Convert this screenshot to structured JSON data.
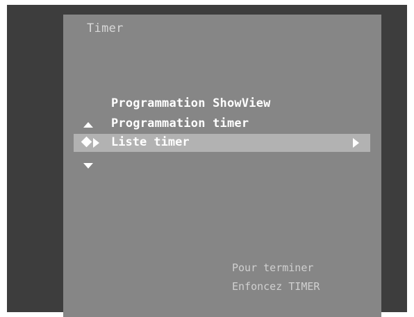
{
  "window": {
    "title": "Timer"
  },
  "menu": {
    "items": [
      {
        "label": "Programmation ShowView"
      },
      {
        "label": "Programmation timer"
      },
      {
        "label": "Liste timer",
        "selected": true
      }
    ],
    "icons": {
      "scroll_up": "up-arrow-icon",
      "scroll_down": "down-arrow-icon",
      "cursor": "diamond-icon",
      "selection": "play-marker-icon",
      "submenu": "right-arrow-icon"
    }
  },
  "footer": {
    "line1": "Pour terminer",
    "line2": "Enfoncez TIMER"
  },
  "colors": {
    "frame": "#3d3d3d",
    "panel": "#868686",
    "highlight": "#b2b2b2",
    "text": "#ffffff"
  }
}
